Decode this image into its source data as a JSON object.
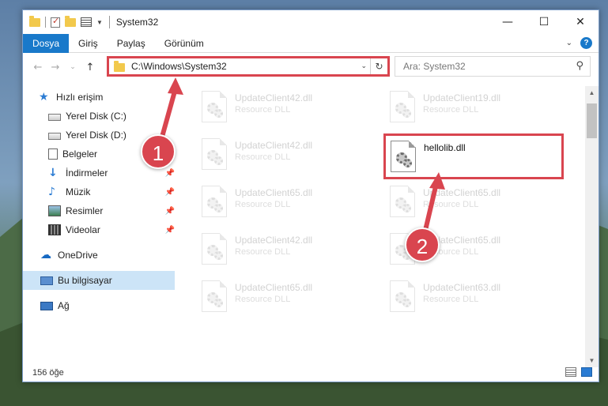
{
  "window": {
    "title": "System32",
    "buttons": {
      "minimize": "—",
      "maximize": "☐",
      "close": "✕"
    }
  },
  "ribbon": {
    "tabs": [
      "Dosya",
      "Giriş",
      "Paylaş",
      "Görünüm"
    ],
    "help": "?"
  },
  "nav": {
    "address": "C:\\Windows\\System32",
    "search_placeholder": "Ara: System32"
  },
  "sidebar": {
    "items": [
      {
        "label": "Hızlı erişim",
        "icon": "star-icon"
      },
      {
        "label": "Yerel Disk (C:)",
        "icon": "disk-icon"
      },
      {
        "label": "Yerel Disk (D:)",
        "icon": "disk-icon"
      },
      {
        "label": "Belgeler",
        "icon": "documents-icon"
      },
      {
        "label": "İndirmeler",
        "icon": "downloads-icon"
      },
      {
        "label": "Müzik",
        "icon": "music-icon"
      },
      {
        "label": "Resimler",
        "icon": "pictures-icon"
      },
      {
        "label": "Videolar",
        "icon": "videos-icon"
      },
      {
        "label": "OneDrive",
        "icon": "cloud-icon"
      },
      {
        "label": "Bu bilgisayar",
        "icon": "computer-icon"
      },
      {
        "label": "Ağ",
        "icon": "network-icon"
      }
    ]
  },
  "files": [
    {
      "name": "UpdateClient42.dll",
      "type": "Resource DLL"
    },
    {
      "name": "UpdateClient19.dll",
      "type": "Resource DLL"
    },
    {
      "name": "UpdateClient42.dll",
      "type": "Resource DLL"
    },
    {
      "name": "hellolib.dll",
      "type": ""
    },
    {
      "name": "UpdateClient65.dll",
      "type": "Resource DLL"
    },
    {
      "name": "UpdateClient65.dll",
      "type": "Resource DLL"
    },
    {
      "name": "UpdateClient42.dll",
      "type": "Resource DLL"
    },
    {
      "name": "UpdateClient65.dll",
      "type": "Resource DLL"
    },
    {
      "name": "UpdateClient65.dll",
      "type": "Resource DLL"
    },
    {
      "name": "UpdateClient63.dll",
      "type": "Resource DLL"
    }
  ],
  "status": {
    "count": "156 öğe"
  },
  "annotations": {
    "step1": "1",
    "step2": "2",
    "color": "#d9454f"
  }
}
